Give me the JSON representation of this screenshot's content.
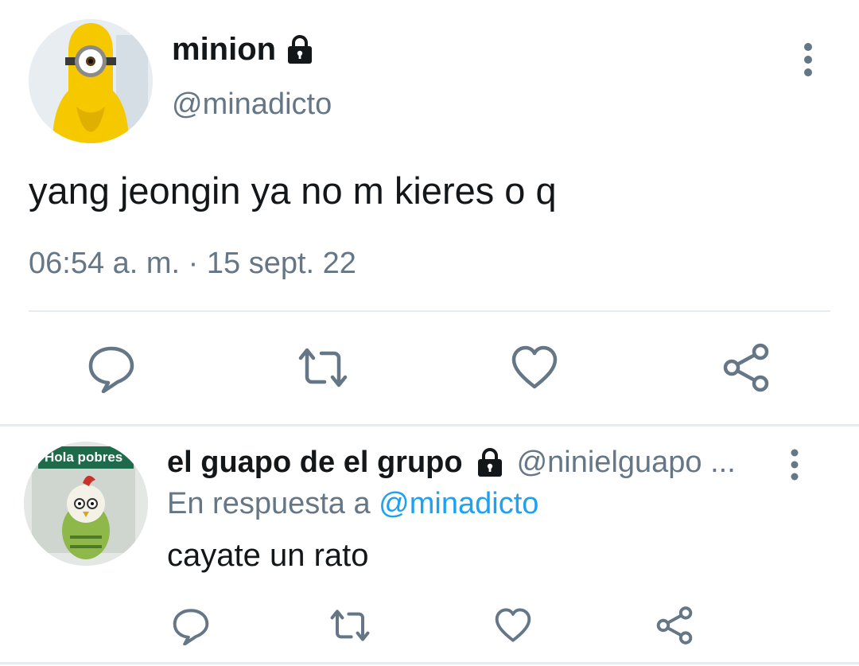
{
  "main_tweet": {
    "display_name": "minion",
    "locked": true,
    "handle": "@minadicto",
    "text": "yang jeongin ya no m kieres o q",
    "timestamp": "06:54 a. m. · 15 sept. 22",
    "avatar": "minion-avatar",
    "actions": [
      "reply-icon",
      "retweet-icon",
      "like-icon",
      "share-icon"
    ]
  },
  "reply_tweet": {
    "display_name": "el guapo de el grupo",
    "locked": true,
    "handle": "@ninielguapo ...",
    "replying_prefix": "En respuesta a",
    "replying_to": "@minadicto",
    "text": "cayate un rato",
    "avatar_caption": "Hola pobres",
    "actions": [
      "reply-icon",
      "retweet-icon",
      "like-icon",
      "share-icon"
    ]
  },
  "colors": {
    "text_primary": "#14171a",
    "text_secondary": "#657786",
    "mention_blue": "#1da1f2",
    "divider": "#e6ecf0"
  }
}
